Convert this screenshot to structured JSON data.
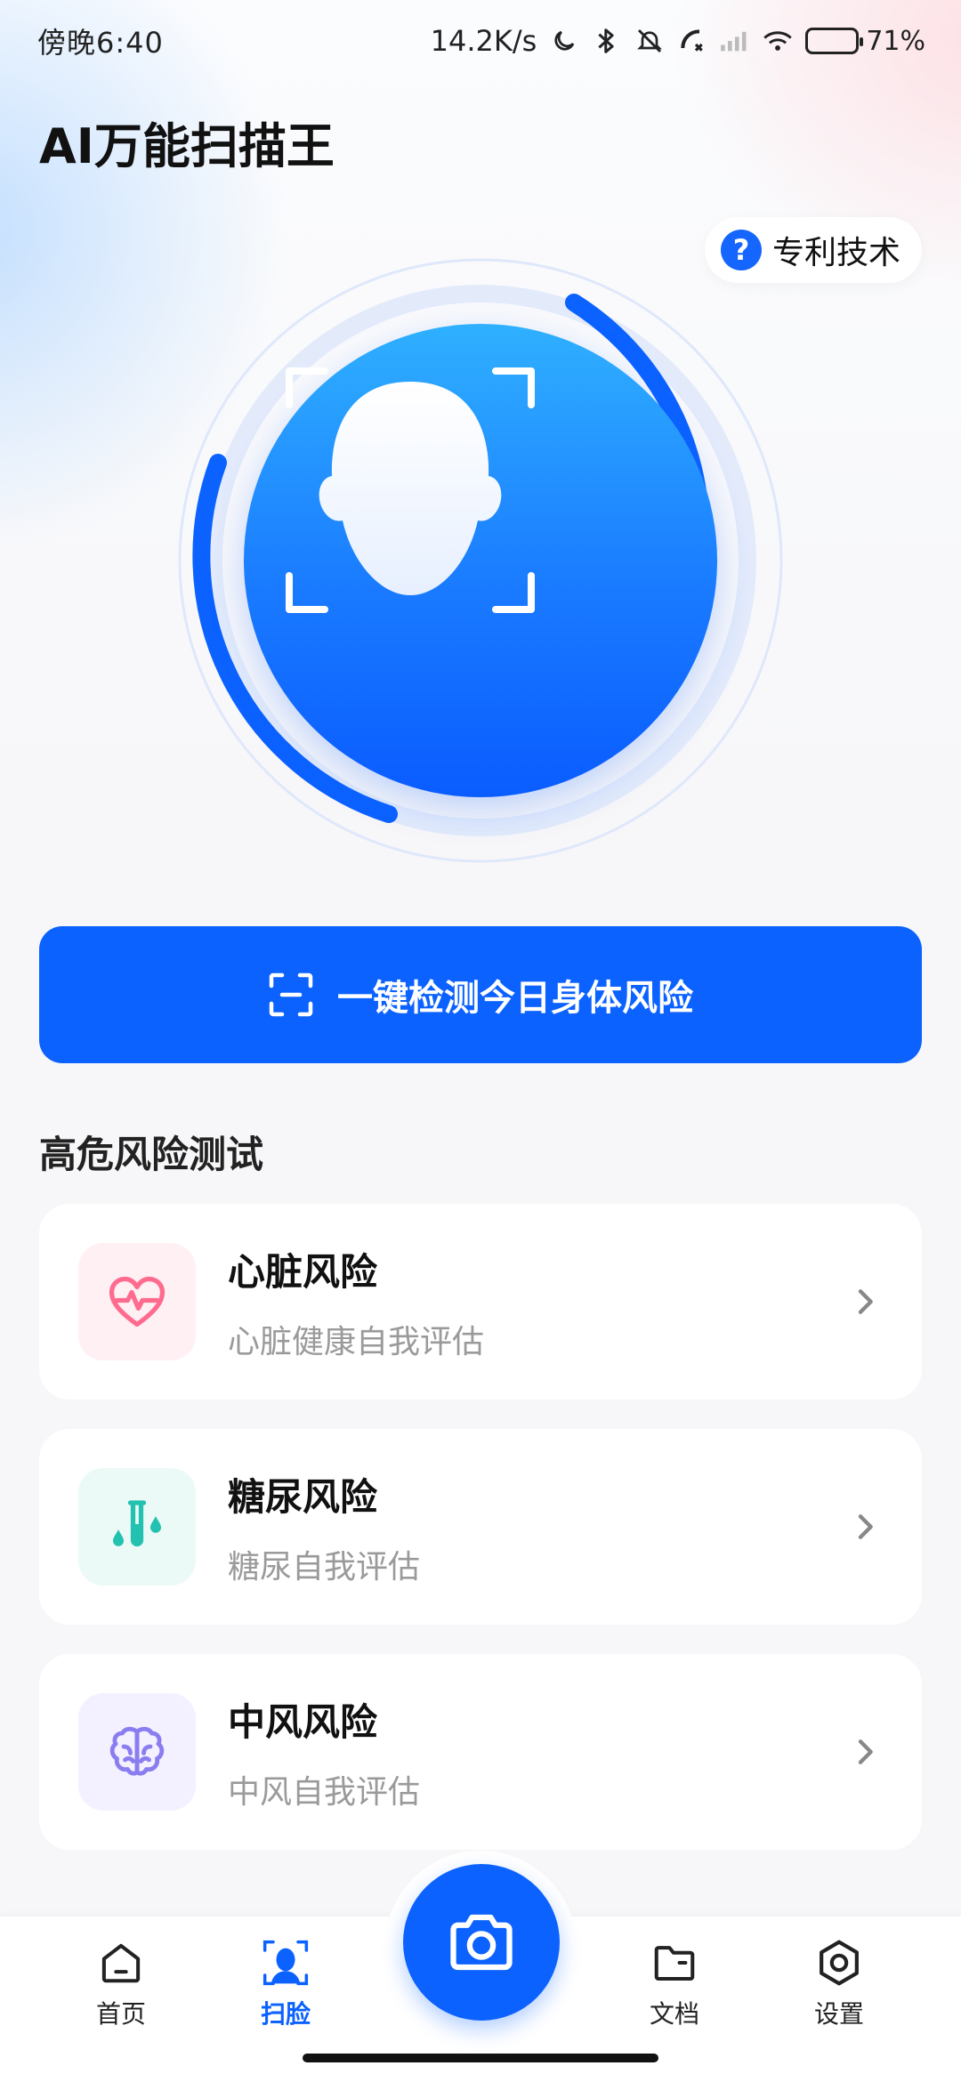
{
  "status_bar": {
    "time": "傍晚6:40",
    "network_speed": "14.2K/s",
    "battery_percent_text": "71%",
    "battery_level": 0.71
  },
  "header": {
    "app_title": "AI万能扫描王",
    "patent_label": "专利技术"
  },
  "scan": {
    "primary_button_label": "一键检测今日身体风险"
  },
  "risk_section": {
    "title": "高危风险测试",
    "items": [
      {
        "title": "心脏风险",
        "subtitle": "心脏健康自我评估",
        "icon": "heart-pulse-icon",
        "tint": "#fff0f4",
        "accent": "#ff6b8f"
      },
      {
        "title": "糖尿风险",
        "subtitle": "糖尿自我评估",
        "icon": "test-tube-drops-icon",
        "tint": "#ecfaf7",
        "accent": "#22c1b0"
      },
      {
        "title": "中风风险",
        "subtitle": "中风自我评估",
        "icon": "brain-icon",
        "tint": "#f3f1ff",
        "accent": "#8a7df0"
      }
    ]
  },
  "bottom_nav": {
    "items": [
      {
        "label": "首页",
        "icon": "home-icon",
        "active": false
      },
      {
        "label": "扫脸",
        "icon": "face-scan-icon",
        "active": true
      },
      {
        "label": "文档",
        "icon": "folder-icon",
        "active": false
      },
      {
        "label": "设置",
        "icon": "settings-hex-icon",
        "active": false
      }
    ],
    "center_icon": "camera-icon"
  },
  "colors": {
    "accent": "#0b62ff",
    "text_secondary": "#9a9a9a"
  }
}
